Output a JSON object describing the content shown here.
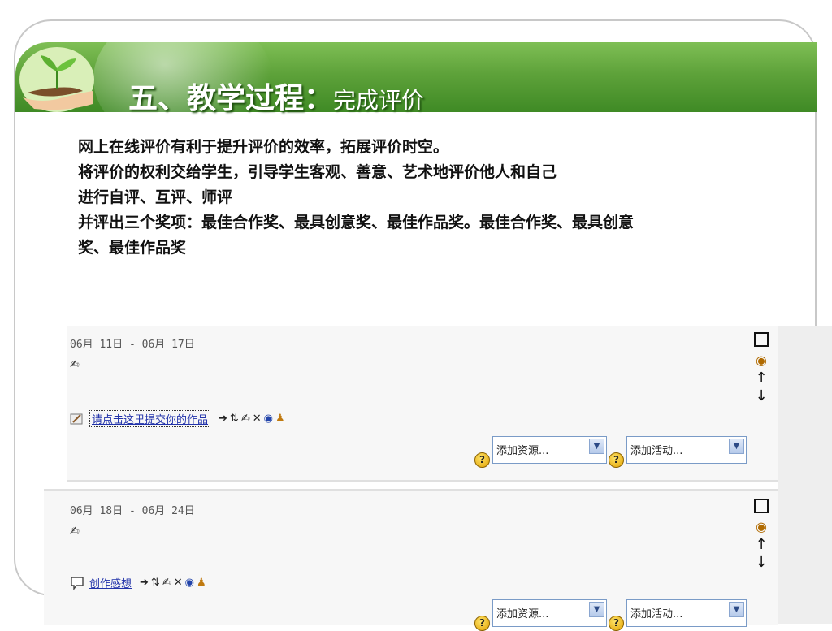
{
  "slide": {
    "title_main": "五、教学过程：",
    "title_sub": "完成评价",
    "paragraphs": [
      "网上在线评价有利于提升评价的效率，拓展评价时空。",
      "将评价的权利交给学生，引导学生客观、善意、艺术地评价他人和自己",
      "进行自评、互评、师评",
      "并评出三个奖项：最佳合作奖、最具创意奖、最佳作品奖。最佳合作奖、最具创意奖、最佳作品奖"
    ]
  },
  "weeks": [
    {
      "date_range": "06月 11日 - 06月 17日",
      "item_label": "请点击这里提交你的作品",
      "add_resource": "添加资源...",
      "add_activity": "添加活动..."
    },
    {
      "date_range": "06月 18日 - 06月 24日",
      "item_label": "创作感想",
      "add_resource": "添加资源...",
      "add_activity": "添加活动..."
    }
  ],
  "icons": {
    "edit": "pen-icon",
    "move_right": "arrow-right-icon",
    "move": "move-icon",
    "delete": "delete-icon",
    "visibility": "eye-icon",
    "roles": "person-icon",
    "help": "help-icon",
    "checkbox": "checkbox-icon",
    "up": "arrow-up-icon",
    "down": "arrow-down-icon"
  },
  "colors": {
    "header_green": "#4f9a30",
    "link_blue": "#2233aa"
  }
}
